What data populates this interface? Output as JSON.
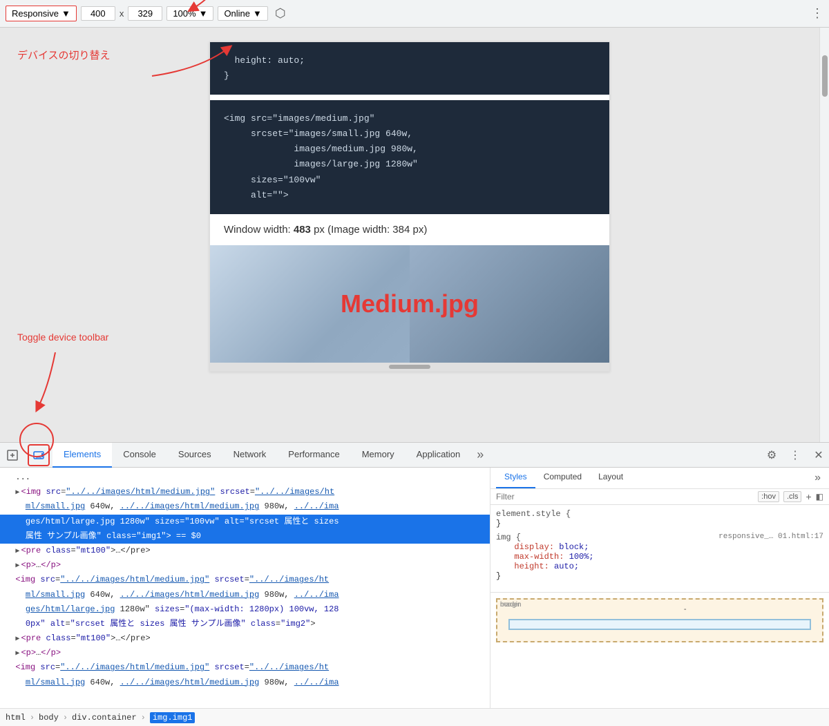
{
  "toolbar": {
    "device_label": "Responsive",
    "width_value": "400",
    "height_value": "329",
    "zoom_label": "100%",
    "online_label": "Online",
    "more_label": "⋮"
  },
  "annotations": {
    "device_switch_text": "デバイスの切り替え",
    "toggle_toolbar_text": "Toggle device toolbar"
  },
  "preview": {
    "code_block1_lines": [
      "  height: auto;",
      "}"
    ],
    "code_block2_lines": [
      "<img src=\"images/medium.jpg\"",
      "     srcset=\"images/small.jpg 640w,",
      "             images/medium.jpg 980w,",
      "             images/large.jpg 1280w\"",
      "     sizes=\"100vw\"",
      "     alt=\"\">"
    ],
    "window_width_text": "Window width: ",
    "window_width_bold": "483",
    "window_width_suffix": " px (Image width: 384 px)",
    "image_label": "Medium.jpg"
  },
  "devtools": {
    "tabs": [
      {
        "label": "Elements",
        "active": true
      },
      {
        "label": "Console",
        "active": false
      },
      {
        "label": "Sources",
        "active": false
      },
      {
        "label": "Network",
        "active": false
      },
      {
        "label": "Performance",
        "active": false
      },
      {
        "label": "Memory",
        "active": false
      },
      {
        "label": "Application",
        "active": false
      }
    ],
    "elements": {
      "lines": [
        {
          "text": "  ...",
          "type": "plain",
          "selected": false,
          "indent": 0
        },
        {
          "html": "<span class='triangle'>▶</span><span class='el-tag'>&lt;img</span> <span class='el-attr'>src</span><span class='el-eq'>=</span><span class='el-link'>\"../../images/html/medium.jpg\"</span> <span class='el-attr'>srcset</span><span class='el-eq'>=</span><span class='el-link'>\"../../images/ht</span>",
          "selected": false,
          "indent": 1
        },
        {
          "html": "<span class='el-link'>ml/small.jpg</span> 640w, <span class='el-link'>../../images/html/medium.jpg</span> 980w, <span class='el-link'>../../ima</span>",
          "selected": false,
          "indent": 2
        },
        {
          "html": "<span class='el-link'>ges/html/large.jpg</span> 1280w\" <span class='el-attr'>sizes</span><span class='el-eq'>=</span><span class='el-val'>\"100vw\"</span> <span class='el-attr'>alt</span><span class='el-eq'>=</span><span class='el-val'>\"srcset 属性と sizes</span>",
          "selected": false,
          "indent": 2
        },
        {
          "html": "<span class='el-val'>属性 サンプル画像\"</span> <span class='el-attr'>class</span><span class='el-eq'>=</span><span class='el-val'>\"img1\"</span>&gt; == <span class='el-dollar'>$0</span>",
          "selected": true,
          "indent": 2
        },
        {
          "html": "<span class='triangle'>▶</span><span class='el-tag'>&lt;pre</span> <span class='el-attr'>class</span><span class='el-eq'>=</span><span class='el-val'>\"mt100\"</span>&gt;…&lt;/pre&gt;",
          "selected": false,
          "indent": 1
        },
        {
          "html": "<span class='triangle'>▶</span><span class='el-tag'>&lt;p&gt;</span>…<span class='el-tag'>&lt;/p&gt;</span>",
          "selected": false,
          "indent": 1
        },
        {
          "html": "<span class='el-tag'>&lt;img</span> <span class='el-attr'>src</span><span class='el-eq'>=</span><span class='el-link'>\"../../images/html/medium.jpg\"</span> <span class='el-attr'>srcset</span><span class='el-eq'>=</span><span class='el-link'>\"../../images/ht</span>",
          "selected": false,
          "indent": 1
        },
        {
          "html": "<span class='el-link'>ml/small.jpg</span> 640w, <span class='el-link'>../../images/html/medium.jpg</span> 980w, <span class='el-link'>../../ima</span>",
          "selected": false,
          "indent": 2
        },
        {
          "html": "<span class='el-link'>ges/html/large.jpg</span> 1280w\" <span class='el-attr'>sizes</span><span class='el-eq'>=</span><span class='el-val'>\"(max-width: 1280px) 100vw, 128</span>",
          "selected": false,
          "indent": 2
        },
        {
          "html": "<span class='el-val'>0px\"</span> <span class='el-attr'>alt</span><span class='el-eq'>=</span><span class='el-val'>\"srcset 属性と sizes 属性 サンプル画像\"</span> <span class='el-attr'>class</span><span class='el-eq'>=</span><span class='el-val'>\"img2\"</span>&gt;",
          "selected": false,
          "indent": 2
        },
        {
          "html": "<span class='triangle'>▶</span><span class='el-tag'>&lt;pre</span> <span class='el-attr'>class</span><span class='el-eq'>=</span><span class='el-val'>\"mt100\"</span>&gt;…&lt;/pre&gt;",
          "selected": false,
          "indent": 1
        },
        {
          "html": "<span class='triangle'>▶</span><span class='el-tag'>&lt;p&gt;</span>…<span class='el-tag'>&lt;/p&gt;</span>",
          "selected": false,
          "indent": 1
        },
        {
          "html": "<span class='el-tag'>&lt;img</span> <span class='el-attr'>src</span><span class='el-eq'>=</span><span class='el-link'>\"../../images/html/medium.jpg\"</span> <span class='el-attr'>srcset</span><span class='el-eq'>=</span><span class='el-link'>\"../../images/ht</span>",
          "selected": false,
          "indent": 1
        },
        {
          "html": "<span class='el-link'>ml/small.jpg</span> 640w, <span class='el-link'>../../images/html/medium.jpg</span> 980w, <span class='el-link'>../../ima</span>",
          "selected": false,
          "indent": 2
        }
      ]
    },
    "styles": {
      "sub_tabs": [
        "Styles",
        "Computed",
        "Layout"
      ],
      "active_sub_tab": "Styles",
      "filter_placeholder": "Filter",
      "hov_label": ":hov",
      "cls_label": ".cls",
      "rules": [
        {
          "selector": "element.style {",
          "close": "}",
          "props": []
        },
        {
          "selector": "img {",
          "source": "responsive_… 01.html:17",
          "close": "}",
          "props": [
            {
              "prop": "display:",
              "val": "block;"
            },
            {
              "prop": "max-width:",
              "val": "100%;"
            },
            {
              "prop": "height:",
              "val": "auto;"
            }
          ]
        }
      ]
    },
    "box_model": {
      "outer_label": "margin",
      "outer_value": "-",
      "inner_label": "border"
    },
    "breadcrumb": {
      "items": [
        "html",
        "body",
        "div.container",
        "img.img1"
      ]
    }
  }
}
